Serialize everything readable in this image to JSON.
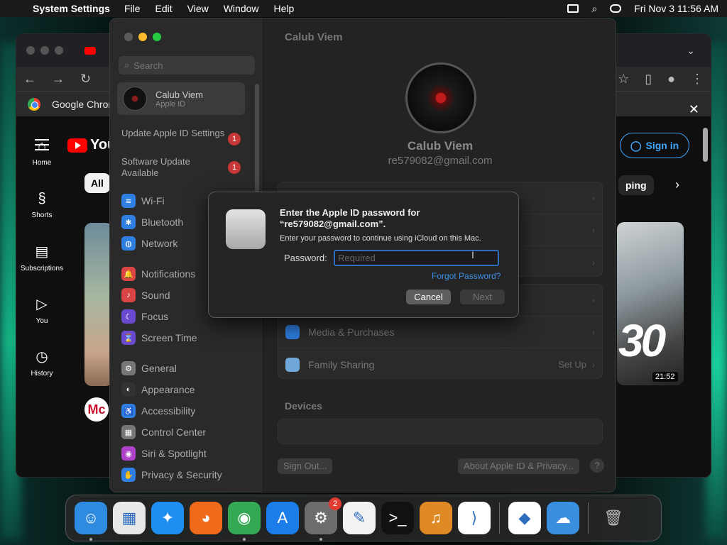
{
  "menubar": {
    "app": "System Settings",
    "items": [
      "File",
      "Edit",
      "View",
      "Window",
      "Help"
    ],
    "datetime": "Fri Nov 3  11:56 AM"
  },
  "chrome": {
    "info_bar_text": "Google Chrome",
    "youtube": {
      "logo_text": "You",
      "chip_all": "All",
      "chip_right": "ping",
      "sign_in": "Sign in",
      "nav": [
        "Home",
        "Shorts",
        "Subscriptions",
        "You",
        "History"
      ],
      "video_number": "30",
      "video_duration": "21:52",
      "channel_avatar_text": "Mc"
    }
  },
  "settings": {
    "search_placeholder": "Search",
    "account_name": "Calub Viem",
    "account_sub": "Apple ID",
    "notices": [
      {
        "label": "Update Apple ID Settings",
        "badge": "1"
      },
      {
        "label": "Software Update Available",
        "badge": "1"
      }
    ],
    "nav_group1": [
      {
        "label": "Wi-Fi",
        "color": "#2f7fe0",
        "icon": "≋"
      },
      {
        "label": "Bluetooth",
        "color": "#2f7fe0",
        "icon": "✱"
      },
      {
        "label": "Network",
        "color": "#2f7fe0",
        "icon": "◍"
      }
    ],
    "nav_group2": [
      {
        "label": "Notifications",
        "color": "#d94545",
        "icon": "🔔"
      },
      {
        "label": "Sound",
        "color": "#d94545",
        "icon": "♪"
      },
      {
        "label": "Focus",
        "color": "#6a4bd0",
        "icon": "☾"
      },
      {
        "label": "Screen Time",
        "color": "#6a4bd0",
        "icon": "⌛"
      }
    ],
    "nav_group3": [
      {
        "label": "General",
        "color": "#777",
        "icon": "⚙"
      },
      {
        "label": "Appearance",
        "color": "#333",
        "icon": "◐"
      },
      {
        "label": "Accessibility",
        "color": "#2f7fe0",
        "icon": "♿"
      },
      {
        "label": "Control Center",
        "color": "#777",
        "icon": "▦"
      },
      {
        "label": "Siri & Spotlight",
        "color": "#b042c9",
        "icon": "◉"
      },
      {
        "label": "Privacy & Security",
        "color": "#2f7fe0",
        "icon": "✋"
      }
    ],
    "main_title": "Calub Viem",
    "profile_name": "Calub Viem",
    "profile_email": "re579082@gmail.com",
    "rows_group2": [
      {
        "label": "Media & Purchases",
        "value": "",
        "color": "#2f7fe0"
      },
      {
        "label": "Family Sharing",
        "value": "Set Up",
        "color": "#6fa7d9"
      }
    ],
    "devices_label": "Devices",
    "sign_out": "Sign Out...",
    "about": "About Apple ID & Privacy...",
    "help": "?"
  },
  "dialog": {
    "title": "Enter the Apple ID password for “re579082@gmail.com”.",
    "message": "Enter your password to continue using iCloud on this Mac.",
    "password_label": "Password:",
    "password_placeholder": "Required",
    "forgot": "Forgot Password?",
    "cancel": "Cancel",
    "next": "Next"
  },
  "dock": {
    "apps": [
      {
        "name": "finder",
        "color": "#2f8be0",
        "icon": "☺",
        "running": true
      },
      {
        "name": "launchpad",
        "color": "#e8e8e8",
        "icon": "▦",
        "running": false
      },
      {
        "name": "safari",
        "color": "#1e8ff0",
        "icon": "✦",
        "running": false
      },
      {
        "name": "firefox",
        "color": "#f06a1c",
        "icon": "◕",
        "running": false
      },
      {
        "name": "chrome",
        "color": "#34a853",
        "icon": "◉",
        "running": true
      },
      {
        "name": "app-store",
        "color": "#1a7de8",
        "icon": "A",
        "running": false
      },
      {
        "name": "system-settings",
        "color": "#6d6d6d",
        "icon": "⚙",
        "running": true,
        "badge": "2"
      },
      {
        "name": "textedit",
        "color": "#f2f2f2",
        "icon": "✎",
        "running": false
      },
      {
        "name": "terminal",
        "color": "#111",
        "icon": ">_",
        "running": false
      },
      {
        "name": "garageband",
        "color": "#e08a25",
        "icon": "♫",
        "running": false
      },
      {
        "name": "vscode",
        "color": "#ffffff",
        "icon": "⟩",
        "running": false
      }
    ],
    "apps_right": [
      {
        "name": "visual-studio",
        "color": "#ffffff",
        "icon": "◆",
        "running": false
      },
      {
        "name": "weather",
        "color": "#3a8ee0",
        "icon": "☁",
        "running": false
      }
    ]
  }
}
